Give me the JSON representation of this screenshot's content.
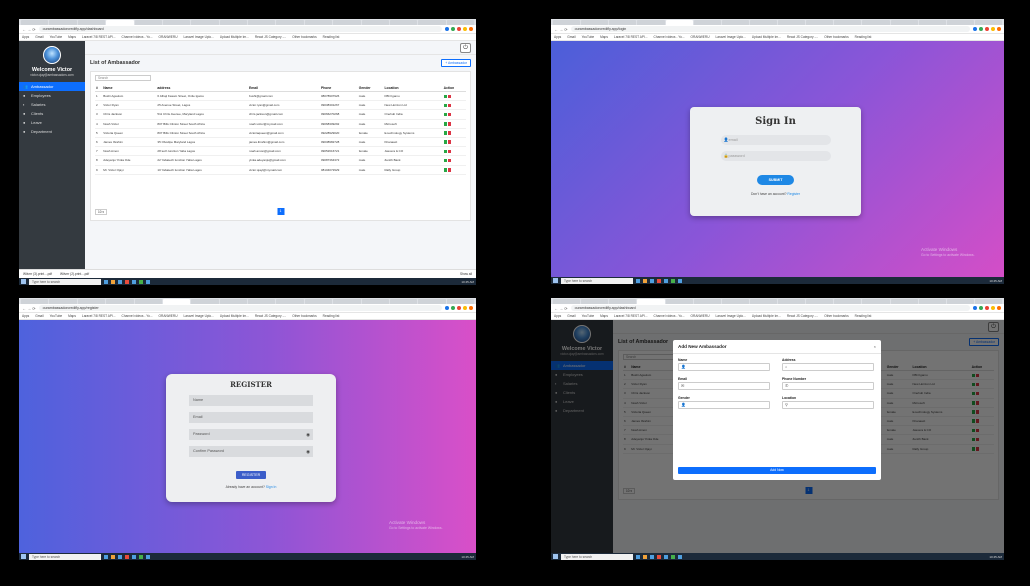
{
  "chrome": {
    "url_dashboard": "ourambassadorcredifly.app/dashboard",
    "url_login": "ourambassadorcredifly.app/login",
    "url_register": "ourambassadorcredifly.app/register",
    "bookmarks": [
      "Apps",
      "Gmail",
      "YouTube",
      "Maps",
      "Laravel 7/8 REST API...",
      "Channel videos - Yo...",
      "ORANWERU",
      "Laravel Image Uplo...",
      "Upload Multiple Im...",
      "React JS Category -...",
      "Other bookmarks",
      "Reading list"
    ],
    "taskbar_search": "Type here to search",
    "watermark_title": "Activate Windows",
    "watermark_sub": "Go to Settings to activate Windows."
  },
  "dashboard": {
    "welcome": "Welcome Victor",
    "email": "victor.ojay@ambassadors.com",
    "menu": [
      "Ambassador",
      "Employees",
      "Salaries",
      "Clients",
      "Leave",
      "Department"
    ],
    "menu_icons": [
      "users-icon",
      "employees-icon",
      "salaries-icon",
      "clients-icon",
      "leave-icon",
      "department-icon"
    ],
    "page_title": "List of Ambassador",
    "add_button": "+ Ambassador",
    "search_placeholder": "Search",
    "columns": [
      "#",
      "Name",
      "address",
      "Email",
      "Phone",
      "Gender",
      "Location",
      "Action"
    ],
    "rows": [
      [
        "1",
        "Bushi Agaulum",
        "6 Alhaji Kasam Street, Onile Igamu",
        "bushi@gmail.com",
        "08078907926",
        "male",
        "FBN Igamu"
      ],
      [
        "2",
        "Victor Ryan",
        "25 Avenue Street, Lagos",
        "victor.ryan@gmail.com",
        "09038301267",
        "male",
        "New Horizon Ltd"
      ],
      [
        "3",
        "Chris Jackson",
        "511 Chris Avenue, Maryland Lagos",
        "chris.jackson@gmail.com",
        "09066270268",
        "male",
        "Onehub India"
      ],
      [
        "4",
        "Noah Victor",
        "807 Bills Clinton Street South Africa",
        "noah.victor@mymail.com",
        "09068309292",
        "male",
        "Microsoft"
      ],
      [
        "5",
        "Victoria Queen",
        "807 Bills Clinton Street South Africa",
        "victoriaqueen@gmail.com",
        "09228929020",
        "female",
        "E-technology Systems"
      ],
      [
        "6",
        "James Ibrahim",
        "35 Obodipe Maryland Lagos",
        "james.ibrahim@gmail.com",
        "09038982728",
        "male",
        "Khanaact"
      ],
      [
        "7",
        "Noah Amon",
        "28 tech lunction Yaba Lagos",
        "noah.amon@gmail.com",
        "09052616721",
        "female",
        "Jasvera & CO"
      ],
      [
        "8",
        "Adeyanju Yinka Ode",
        "22 Yabatech lunction Yaba Lagos",
        "yinka.adeyanju@gmail.com",
        "09087364372",
        "male",
        "Zenith Bank"
      ],
      [
        "9",
        "Mr. Victor Ojayi",
        "10 Yabatech lunction Yaba Lagos",
        "victor.ojayi@mymail.com",
        "08104072929",
        "male",
        "Rally Group"
      ]
    ],
    "per_page": "10 ▾",
    "page": "1",
    "downloads": [
      "Wiivrrr (3).print....pdf",
      "Wiivrrr (2).print....pdf"
    ],
    "show_all": "Show all",
    "clock": "10:45 AM"
  },
  "login": {
    "title": "Sign In",
    "email_placeholder": "email",
    "password_placeholder": "password",
    "submit": "SUBMIT",
    "footer_text": "Don't have an account?",
    "footer_link": "Register"
  },
  "register": {
    "title": "REGISTER",
    "name_placeholder": "Name",
    "email_placeholder": "Email",
    "password_placeholder": "Password",
    "confirm_placeholder": "Confirm Password",
    "button": "REGISTER",
    "footer_text": "Already have an account?",
    "footer_link": "Sign In"
  },
  "modal": {
    "title": "Add New Ambassador",
    "close": "×",
    "fields": [
      "Name",
      "Address",
      "Email",
      "Phone Number",
      "Gender",
      "Location"
    ],
    "button": "Add Now"
  }
}
